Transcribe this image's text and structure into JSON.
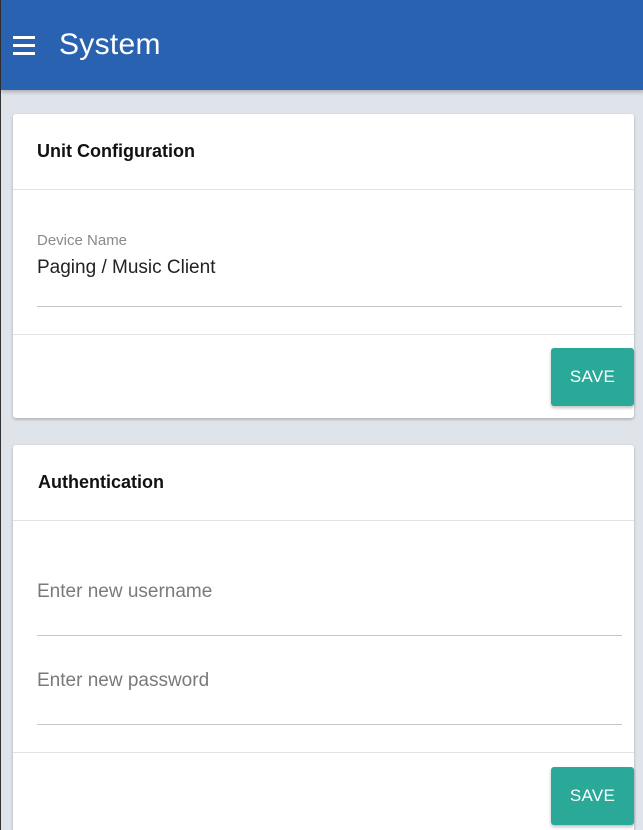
{
  "appbar": {
    "title": "System",
    "menu_icon": "hamburger-menu-icon",
    "background": "#2862b0"
  },
  "unit_config": {
    "title": "Unit Configuration",
    "device_name": {
      "label": "Device Name",
      "value": "Paging / Music Client"
    },
    "save_label": "SAVE"
  },
  "authentication": {
    "title": "Authentication",
    "username": {
      "placeholder": "Enter new username",
      "value": ""
    },
    "password": {
      "placeholder": "Enter new password",
      "value": ""
    },
    "save_label": "SAVE"
  },
  "colors": {
    "accent": "#2aa898",
    "page_background": "#dfe4ea"
  }
}
